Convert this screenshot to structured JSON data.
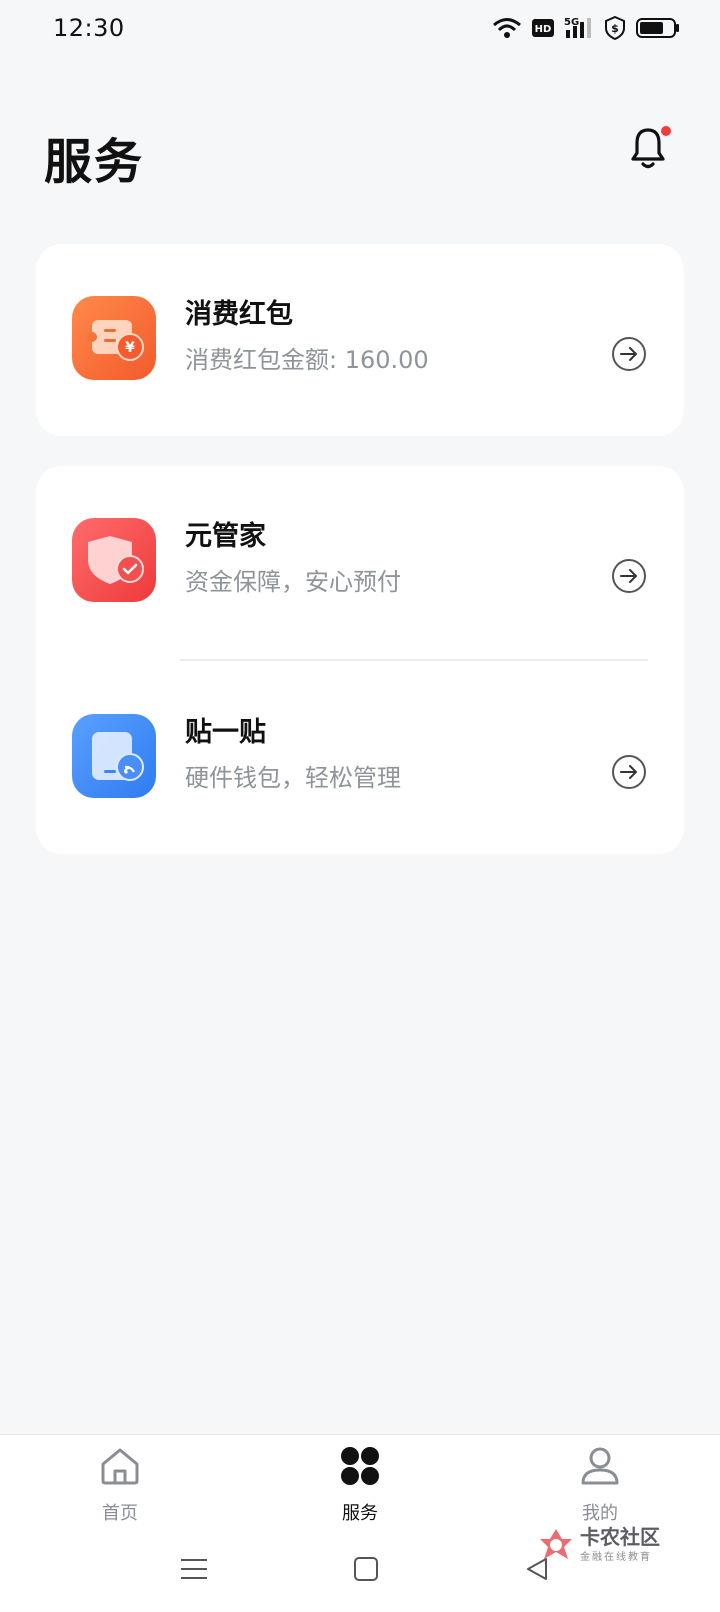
{
  "status_bar": {
    "time": "12:30",
    "icons": [
      "wifi-icon",
      "hd-icon",
      "signal-5g-icon",
      "shield-dollar-icon",
      "battery-icon"
    ],
    "hd_label": "HD",
    "network_label": "5G"
  },
  "header": {
    "title": "服务",
    "notification_icon": "bell-icon",
    "notification_dot_color": "#f43b3b"
  },
  "cards": {
    "consumption": {
      "title": "消费红包",
      "subtitle": "消费红包金额: 160.00",
      "icon": "red-envelope-icon",
      "icon_badge": "¥"
    },
    "steward": {
      "title": "元管家",
      "subtitle": "资金保障，安心预付",
      "icon": "shield-check-icon"
    },
    "tap": {
      "title": "贴一贴",
      "subtitle": "硬件钱包，轻松管理",
      "icon": "nfc-card-icon"
    }
  },
  "bottom_nav": {
    "items": [
      {
        "label": "首页",
        "icon": "home-icon",
        "active": false
      },
      {
        "label": "服务",
        "icon": "grid-icon",
        "active": true
      },
      {
        "label": "我的",
        "icon": "user-icon",
        "active": false
      }
    ]
  },
  "watermark": {
    "title": "卡农社区",
    "subtitle": "金融在线教育"
  },
  "colors": {
    "background": "#f6f7f9",
    "accent_orange": "#ff6a3d",
    "accent_red": "#f04848",
    "accent_blue": "#3a86f7"
  }
}
